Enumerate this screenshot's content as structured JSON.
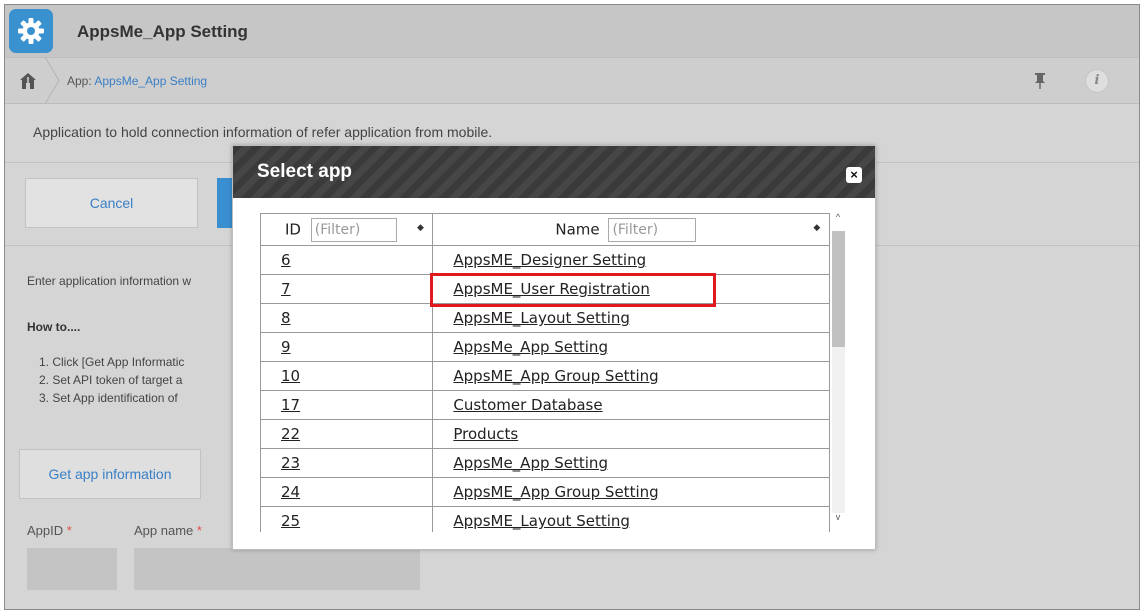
{
  "header": {
    "title": "AppsMe_App Setting",
    "icon": "gear-icon",
    "accent": "#3a91cf"
  },
  "breadcrumb": {
    "prefix": "App: ",
    "link": "AppsMe_App Setting",
    "home_icon": "home-icon",
    "pin_icon": "pin-icon",
    "info_icon_text": "i"
  },
  "description": "Application to hold connection information of refer application from mobile.",
  "toolbar": {
    "cancel_label": "Cancel"
  },
  "content": {
    "enter_info": "Enter application information w",
    "howto": "How to....",
    "steps": [
      "1. Click [Get App Informatic",
      "2. Set API token of target a",
      "3. Set App identification of"
    ],
    "get_app_label": "Get app information",
    "appid_label": "AppID",
    "appname_label": "App name",
    "required_mark": "*"
  },
  "modal": {
    "title": "Select app",
    "close_label": "×",
    "columns": {
      "id": "ID",
      "name": "Name",
      "filter_placeholder": "(Filter)",
      "sort_icon": "◆"
    },
    "rows": [
      {
        "id": "6",
        "name": "AppsME_Designer Setting"
      },
      {
        "id": "7",
        "name": "AppsME_User Registration"
      },
      {
        "id": "8",
        "name": "AppsME_Layout Setting"
      },
      {
        "id": "9",
        "name": "AppsMe_App Setting"
      },
      {
        "id": "10",
        "name": "AppsME_App Group Setting"
      },
      {
        "id": "17",
        "name": "Customer Database"
      },
      {
        "id": "22",
        "name": "Products"
      },
      {
        "id": "23",
        "name": "AppsMe_App Setting"
      },
      {
        "id": "24",
        "name": "AppsME_App Group Setting"
      },
      {
        "id": "25",
        "name": "AppsME_Layout Setting"
      }
    ],
    "highlight_color": "#e0191e"
  }
}
